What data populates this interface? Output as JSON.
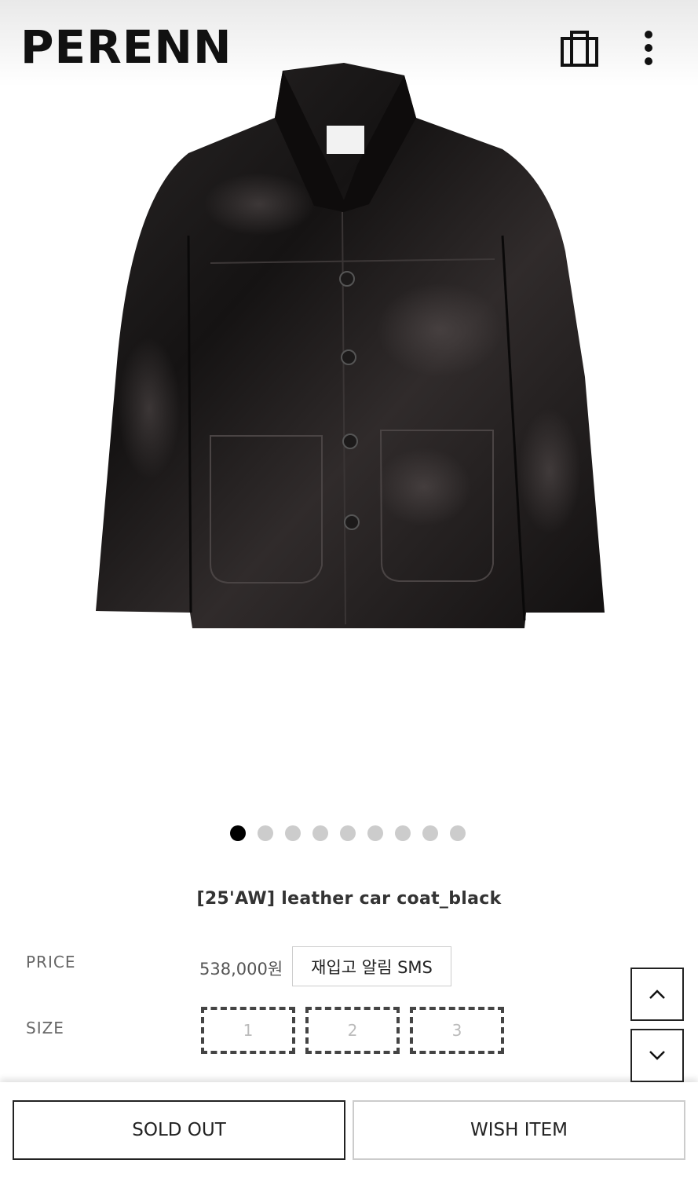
{
  "header": {
    "logo": "PERENN",
    "cart_icon": "shopping-bag-icon",
    "menu_icon": "more-vertical-icon"
  },
  "gallery": {
    "image": "black leather car coat",
    "total_slides": 9,
    "active_slide": 1
  },
  "product": {
    "title": "[25'AW] leather car coat_black",
    "price_label": "PRICE",
    "price": "538,000원",
    "restock_button": "재입고 알림 SMS",
    "size_label": "SIZE",
    "sizes": [
      "1",
      "2",
      "3"
    ]
  },
  "scroll": {
    "up_icon": "chevron-up-icon",
    "down_icon": "chevron-down-icon"
  },
  "actions": {
    "sold_out": "SOLD OUT",
    "wish": "WISH ITEM"
  },
  "colors": {
    "accent": "#000000",
    "dot_inactive": "#cccccc"
  }
}
